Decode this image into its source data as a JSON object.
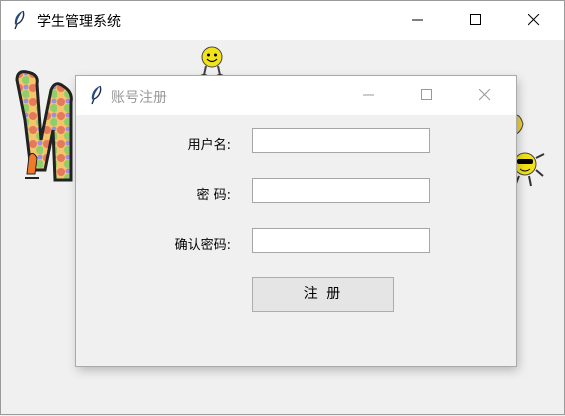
{
  "main_window": {
    "title": "学生管理系统",
    "controls": [
      "minimize",
      "maximize",
      "close"
    ]
  },
  "register_dialog": {
    "title": "账号注册",
    "fields": [
      {
        "label": "用户名:",
        "value": ""
      },
      {
        "label": "密 码:",
        "value": ""
      },
      {
        "label": "确认密码:",
        "value": ""
      }
    ],
    "submit_label": "注 册"
  },
  "icons": {
    "app_icon": "feather-icon",
    "background_decor": [
      "smiley-face-icon",
      "smiley-with-sunglasses-icon",
      "letter-w-graphic"
    ]
  },
  "colors": {
    "titlebar_bg": "#ffffff",
    "window_bg": "#f0f0f0",
    "inactive_title": "#999999"
  }
}
